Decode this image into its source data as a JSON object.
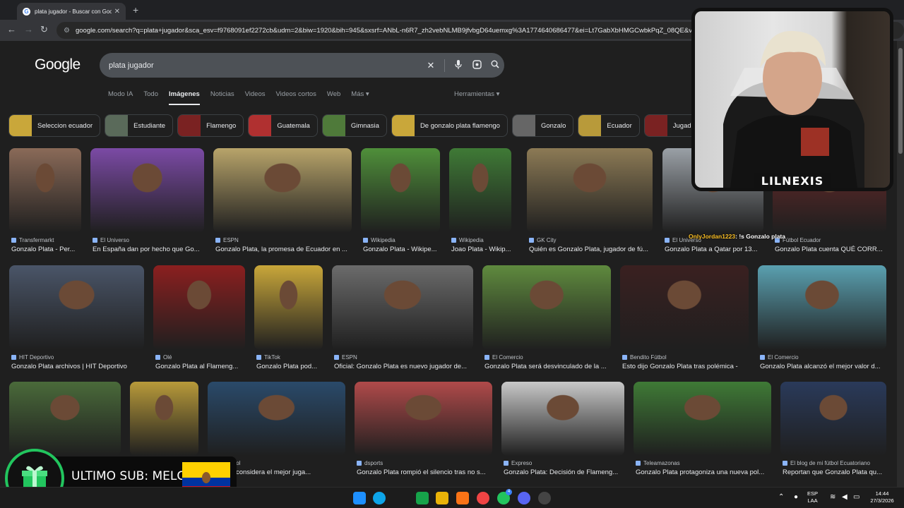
{
  "browser": {
    "tab_title": "plata jugador - Buscar con Google",
    "tab_close": "✕",
    "new_tab": "+",
    "url": "google.com/search?q=plata+jugador&sca_esv=f9768091ef2272cb&udm=2&biw=1920&bih=945&sxsrf=ANbL-n6R7_zh2vebNLMB9jfvbgD64uemxg%3A1774640686477&ei=Lt7GabXbHMGCwbkPqZ_08QE&ved=0"
  },
  "google": {
    "logo": "Google",
    "query": "plata jugador",
    "tabs": [
      "Modo IA",
      "Todo",
      "Imágenes",
      "Noticias",
      "Videos",
      "Videos cortos",
      "Web",
      "Más ▾"
    ],
    "tools": "Herramientas ▾",
    "chips": [
      "Seleccion ecuador",
      "Estudiante",
      "Flamengo",
      "Guatemala",
      "Gimnasia",
      "De gonzalo plata flamengo",
      "Gonzalo",
      "Ecuador",
      "Jugador"
    ]
  },
  "results": [
    {
      "source": "Transfermarkt",
      "caption": "Gonzalo Plata - Per...",
      "bg": "#8a6a58"
    },
    {
      "source": "El Universo",
      "caption": "En España dan por hecho que Go...",
      "bg": "#7b4aa5"
    },
    {
      "source": "ESPN",
      "caption": "Gonzalo Plata, la promesa de Ecuador en ...",
      "bg": "#b8a46a"
    },
    {
      "source": "Wikipedia",
      "caption": "Gonzalo Plata - Wikipe...",
      "bg": "#4f8f3a"
    },
    {
      "source": "Wikipedia",
      "caption": "Joao Plata - Wikip...",
      "bg": "#3f7a36"
    },
    {
      "source": "GK City",
      "caption": "Quién es Gonzalo Plata, jugador de fú...",
      "bg": "#8c7a55"
    },
    {
      "source": "El Universo",
      "caption": "Gonzalo Plata a Qatar por 13...",
      "bg": "#9aa0a6"
    },
    {
      "source": "Fútbol Ecuador",
      "caption": "Gonzalo Plata cuenta QUÉ CORR...",
      "bg": "#6e2a2a"
    },
    {
      "source": "HIT Deportivo",
      "caption": "Gonzalo Plata archivos | HIT Deportivo",
      "bg": "#4a5568"
    },
    {
      "source": "Olé",
      "caption": "Gonzalo Plata al Flameng...",
      "bg": "#8b1f1f"
    },
    {
      "source": "TikTok",
      "caption": "Gonzalo Plata pod...",
      "bg": "#c9a73a"
    },
    {
      "source": "ESPN",
      "caption": "Oficial: Gonzalo Plata es nuevo jugador de...",
      "bg": "#6b6b6b"
    },
    {
      "source": "El Comercio",
      "caption": "Gonzalo Plata será desvinculado de la ...",
      "bg": "#5f8a3e"
    },
    {
      "source": "Bendito Fútbol",
      "caption": "Esto dijo Gonzalo Plata tras polémica -",
      "bg": "#3a2020"
    },
    {
      "source": "El Comercio",
      "caption": "Gonzalo Plata alcanzó el mejor valor d...",
      "bg": "#5aa0b0"
    },
    {
      "source": "",
      "caption": "",
      "bg": "#4a6a3a"
    },
    {
      "source": "",
      "caption": "",
      "bg": "#b89a3a"
    },
    {
      "source": "del fútbol",
      "caption": "Plata se considera el mejor juga...",
      "bg": "#2a4a6a"
    },
    {
      "source": "dsports",
      "caption": "Gonzalo Plata rompió el silencio tras no s...",
      "bg": "#b04a4a"
    },
    {
      "source": "Expreso",
      "caption": "Gonzalo Plata: Decisión de Flameng...",
      "bg": "#c8c8c8"
    },
    {
      "source": "Teleamazonas",
      "caption": "Gonzalo Plata protagoniza una nueva pol...",
      "bg": "#3f7a36"
    },
    {
      "source": "El blog de mi fútbol Ecuatoriano",
      "caption": "Reportan que Gonzalo Plata qu...",
      "bg": "#2a3a5a"
    }
  ],
  "stream": {
    "streamer": "LILNEXIS",
    "chat_user": "OnlyJordan1223",
    "chat_msg": ": !s Gonzalo plata",
    "sub_text": "ULTIMO SUB: MELC"
  },
  "taskbar": {
    "lang": "ESP",
    "lang2": "LAA",
    "time": "14:44",
    "date": "27/3/2026",
    "whatsapp_badge": "4"
  }
}
